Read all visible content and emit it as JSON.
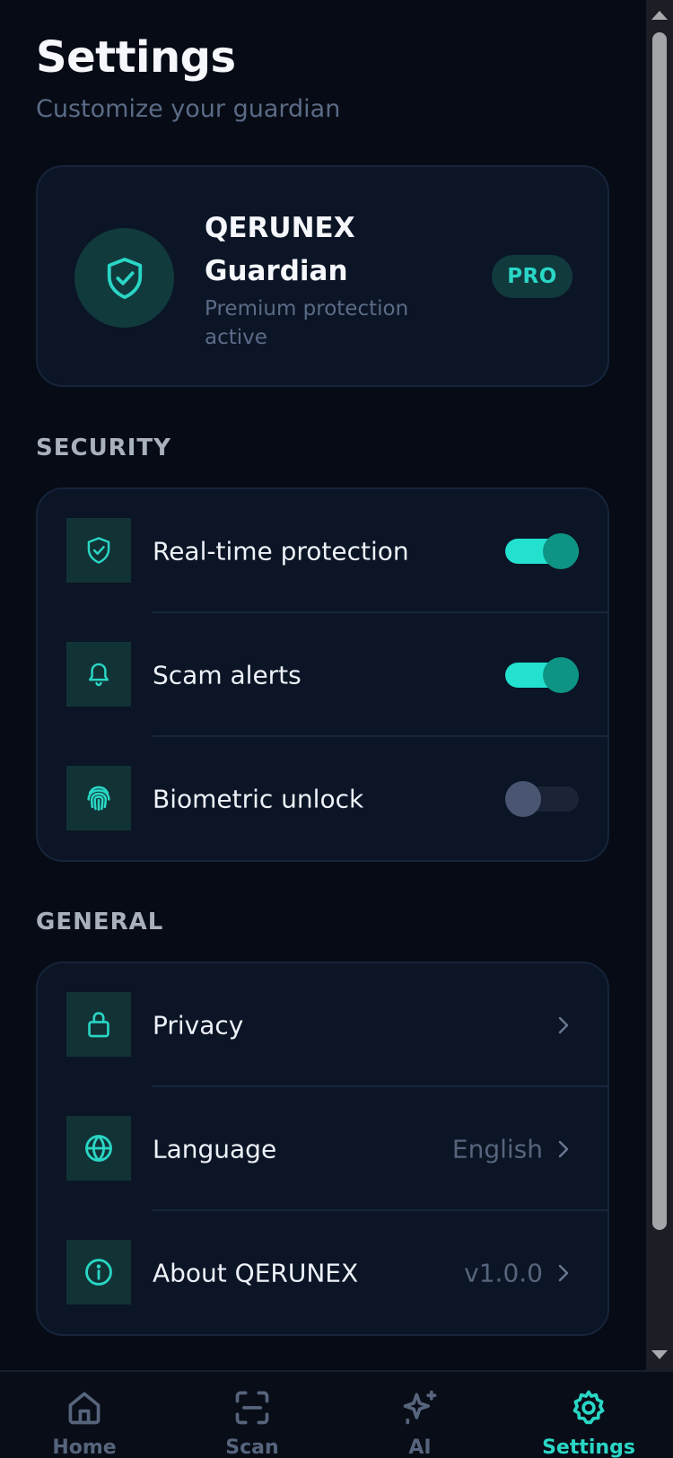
{
  "header": {
    "title": "Settings",
    "subtitle": "Customize your guardian"
  },
  "profile": {
    "name": "QERUNEX Guardian",
    "status": "Premium protection active",
    "badge": "PRO",
    "icon": "shield-check-icon"
  },
  "security": {
    "label": "SECURITY",
    "items": [
      {
        "label": "Real-time protection",
        "icon": "shield-check-icon",
        "enabled": true
      },
      {
        "label": "Scam alerts",
        "icon": "bell-icon",
        "enabled": true
      },
      {
        "label": "Biometric unlock",
        "icon": "fingerprint-icon",
        "enabled": false
      }
    ]
  },
  "general": {
    "label": "GENERAL",
    "items": [
      {
        "label": "Privacy",
        "icon": "lock-icon",
        "value": ""
      },
      {
        "label": "Language",
        "icon": "globe-icon",
        "value": "English"
      },
      {
        "label": "About QERUNEX",
        "icon": "info-icon",
        "value": "v1.0.0"
      }
    ]
  },
  "nav": {
    "items": [
      {
        "label": "Home",
        "icon": "home-icon",
        "active": false
      },
      {
        "label": "Scan",
        "icon": "scan-icon",
        "active": false
      },
      {
        "label": "AI",
        "icon": "sparkle-icon",
        "active": false
      },
      {
        "label": "Settings",
        "icon": "gear-icon",
        "active": true
      }
    ]
  },
  "colors": {
    "accent": "#2ad6c5",
    "background": "#060b15",
    "card": "#0b1526",
    "muted": "#5b6b86"
  }
}
